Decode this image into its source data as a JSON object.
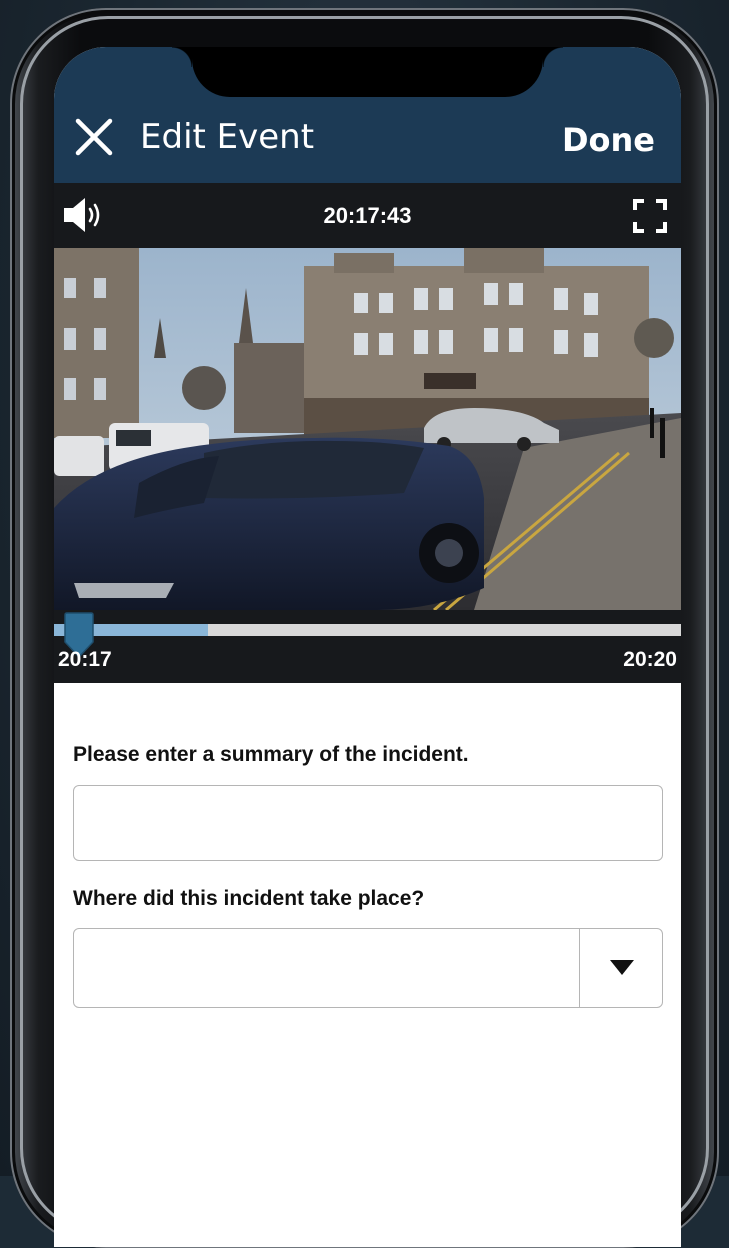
{
  "header": {
    "title": "Edit Event",
    "done_label": "Done",
    "close_icon": "close-icon",
    "background_color": "#1c3a55"
  },
  "video": {
    "timestamp": "20:17:43",
    "volume_icon": "volume-icon",
    "fullscreen_icon": "fullscreen-icon",
    "scrubber": {
      "start_label": "20:17",
      "end_label": "20:20",
      "played_fraction": 0.04,
      "buffered_fraction": 0.245,
      "buffer_color": "#8ab6d8",
      "handle_color": "#2e6e96"
    }
  },
  "form": {
    "summary_label": "Please enter a summary of the incident.",
    "summary_value": "",
    "summary_placeholder": "",
    "location_label": "Where did this incident take place?",
    "location_value": "",
    "dropdown_icon": "dropdown-arrow-icon"
  }
}
